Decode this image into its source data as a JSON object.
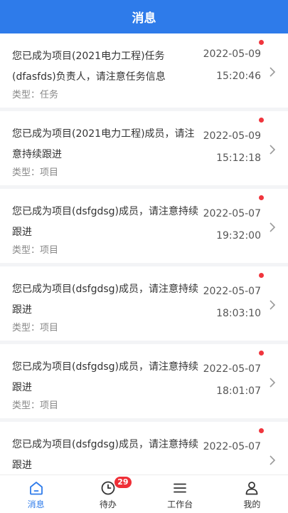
{
  "header": {
    "title": "消息"
  },
  "messages": [
    {
      "text": "您已成为项目(2021电力工程)任务(dfasfds)负责人，请注意任务信息",
      "type": "类型：任务",
      "date": "2022-05-09",
      "time": "15:20:46"
    },
    {
      "text": "您已成为项目(2021电力工程)成员，请注意持续跟进",
      "type": "类型：项目",
      "date": "2022-05-09",
      "time": "15:12:18"
    },
    {
      "text": "您已成为项目(dsfgdsg)成员，请注意持续跟进",
      "type": "类型：项目",
      "date": "2022-05-07",
      "time": "19:32:00"
    },
    {
      "text": "您已成为项目(dsfgdsg)成员，请注意持续跟进",
      "type": "类型：项目",
      "date": "2022-05-07",
      "time": "18:03:10"
    },
    {
      "text": "您已成为项目(dsfgdsg)成员，请注意持续跟进",
      "type": "类型：项目",
      "date": "2022-05-07",
      "time": "18:01:07"
    },
    {
      "text": "您已成为项目(dsfgdsg)成员，请注意持续跟进",
      "type": "",
      "date": "2022-05-07",
      "time": ""
    }
  ],
  "unread_dot_color": "#f0353d",
  "tabbar": {
    "items": [
      {
        "label": "消息",
        "icon": "home-icon",
        "active": true
      },
      {
        "label": "待办",
        "icon": "clock-icon",
        "badge": "29"
      },
      {
        "label": "工作台",
        "icon": "menu-icon"
      },
      {
        "label": "我的",
        "icon": "user-icon"
      }
    ]
  },
  "colors": {
    "accent": "#2e7bea",
    "badge": "#ef2f37"
  }
}
